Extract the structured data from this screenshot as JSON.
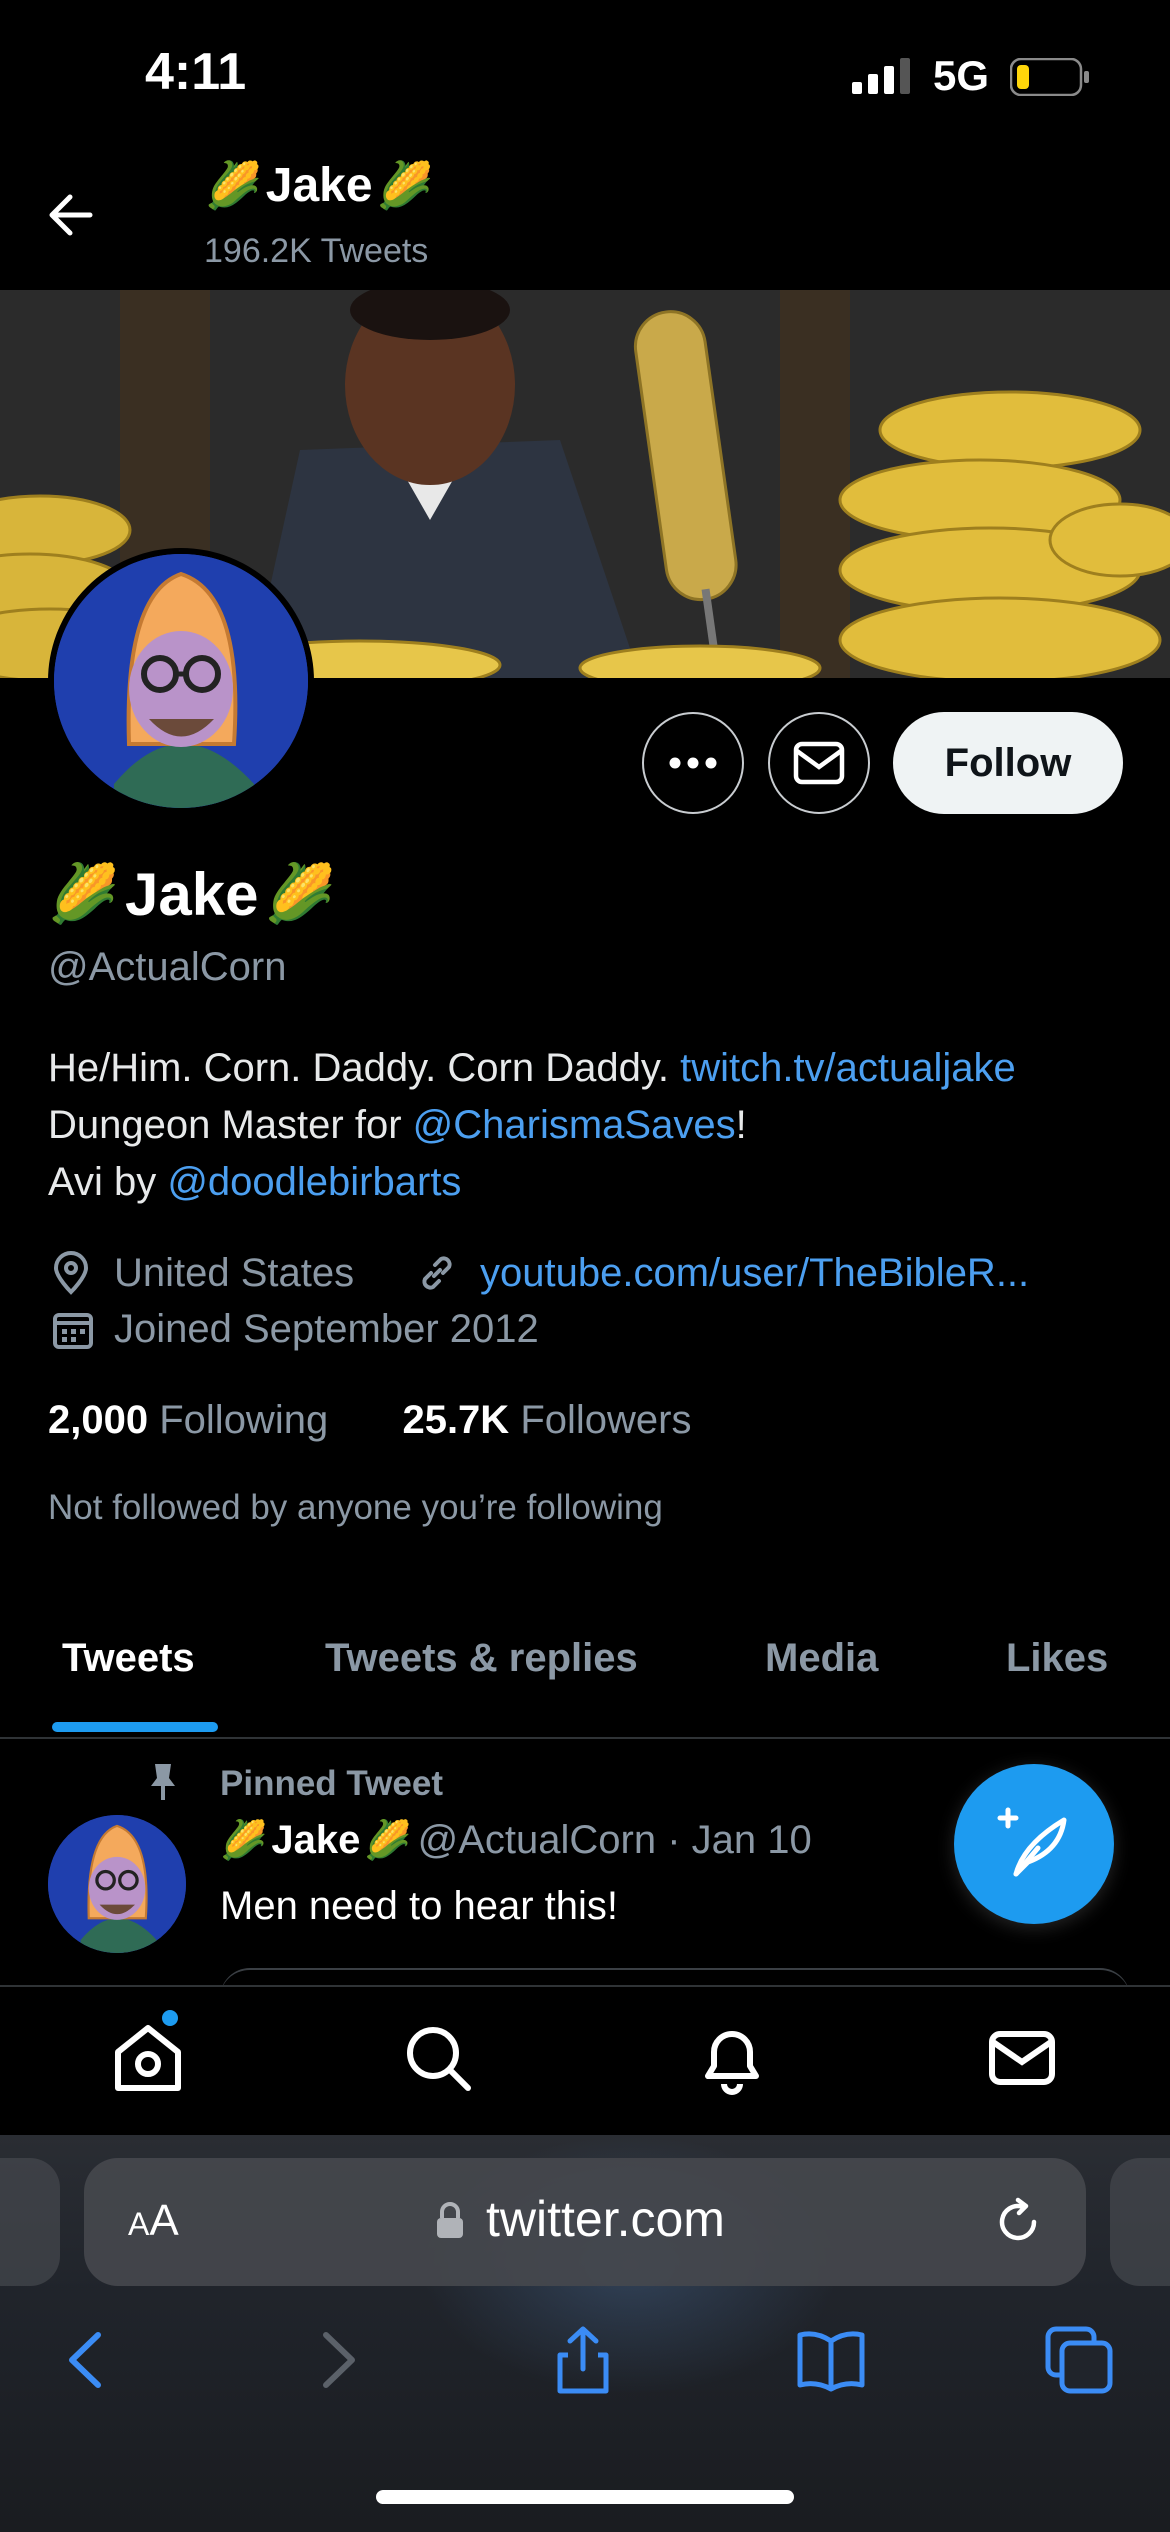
{
  "status": {
    "time": "4:11",
    "network": "5G"
  },
  "header": {
    "name": "Jake",
    "name_emoji": "🌽",
    "tweet_count": "196.2K Tweets"
  },
  "profile": {
    "name": "Jake",
    "name_emoji": "🌽",
    "handle": "@ActualCorn",
    "follow_label": "Follow",
    "bio": {
      "line1_text": "He/Him. Corn. Daddy. Corn Daddy. ",
      "line1_link": "twitch.tv/actualjake",
      "line2_text": "Dungeon Master for ",
      "line2_link": "@CharismaSaves",
      "line2_suffix": "!",
      "line3_text": "Avi by ",
      "line3_link": "@doodlebirbarts"
    },
    "location": "United States",
    "website": "youtube.com/user/TheBibleR...",
    "joined": "Joined September 2012",
    "following_count": "2,000",
    "following_label": "Following",
    "followers_count": "25.7K",
    "followers_label": "Followers",
    "not_followed": "Not followed by anyone you’re following"
  },
  "tabs": [
    {
      "label": "Tweets",
      "active": true
    },
    {
      "label": "Tweets & replies"
    },
    {
      "label": "Media"
    },
    {
      "label": "Likes"
    }
  ],
  "pinned_tweet": {
    "pinned_label": "Pinned Tweet",
    "author_name": "Jake",
    "author_emoji": "🌽",
    "meta": "@ActualCorn · Jan 10",
    "text": "Men need to hear this!"
  },
  "bottom_nav": [
    "home-icon",
    "search-icon",
    "bell-icon",
    "mail-icon"
  ],
  "browser": {
    "text_size_label_small": "A",
    "text_size_label_large": "A",
    "url": "twitter.com"
  },
  "colors": {
    "accent": "#1d9bf0",
    "link": "#4c9ff0",
    "muted": "#8b98a5",
    "background": "#000000"
  }
}
